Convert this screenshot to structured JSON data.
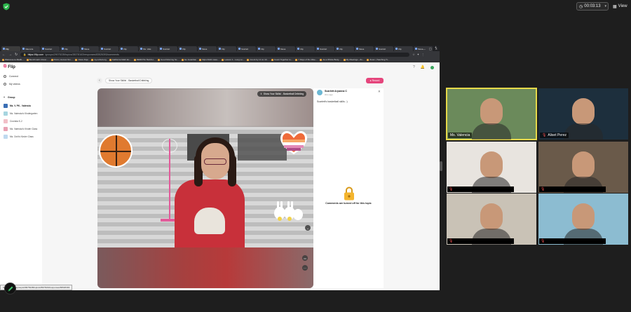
{
  "meeting": {
    "timer": "00:03:13",
    "view_label": "View",
    "colors": {
      "bar_bg": "#1e1e1e",
      "active_speaker": "#e6d94a",
      "mic_muted": "#ff5454"
    }
  },
  "browser": {
    "tabs": [
      "Flip",
      "Valencia",
      "Scarlett",
      "Flip",
      "Mesa",
      "Scarlett",
      "Flip",
      "Ms. Vale",
      "Scarlett",
      "Flip",
      "Mesa",
      "Flip",
      "Scarlett",
      "Flip",
      "Mesa",
      "Flip",
      "Scarlett",
      "Flip",
      "Mesa",
      "Scarlett",
      "Flip",
      "Mesa"
    ],
    "url_host": "https://flip.com",
    "url_path": "/groups/29075228/topics/28378163/responses/83526393/comments",
    "bookmarks": [
      "Welcome to Marlb...",
      "Benchmark Univer...",
      "Point | Human Sm...",
      "Class Dojo",
      "my.cuhsd.org",
      "California Math Ex...",
      "REMOTE TEACH...",
      "Good Morning Sc...",
      "Go Guardian",
      "https://kidz.nasa...",
      "Lesson 1 - Long vo...",
      "Count by 1's to 10...",
      "Count Together to...",
      "7 Days of the Wee...",
      "As a Whole Body...",
      "My Meetings - Zo...",
      "Zoom | Teaching Ti..."
    ],
    "status_tip": "https://flip.com/groups/29075228/topics/28378163/responses/83526393"
  },
  "flip": {
    "logo": "Flip",
    "nav": {
      "connect": "Connect",
      "my_videos": "My videos"
    },
    "group_header": "Group",
    "groups": [
      {
        "label": "Ms. V. PK - Valencia",
        "active": true,
        "color": "#3b6fb5"
      },
      {
        "label": "Ms. Valencia's Kindergarten",
        "active": false,
        "color": "#a7d5e0"
      },
      {
        "label": "Cronista K-2",
        "active": false,
        "color": "#f2c0c8"
      },
      {
        "label": "Ms. Valencia's Kinder Class",
        "active": false,
        "color": "#e8a1b3"
      },
      {
        "label": "Ms. Ochi's Kinder Class",
        "active": false,
        "color": "#bfd9ef"
      }
    ],
    "topic_title": "Show Your Skills! - Basketball Dribbling",
    "record_label": "Record",
    "video_title": "Show Your Skills! - Basketball Dribbling",
    "response": {
      "author": "Scarlett Aryanna C",
      "time": "2mo ago",
      "caption": "Scarlett's basketball skills. :)",
      "comments_off": "Comments are turned off for this topic"
    },
    "colors": {
      "brand": "#e5457c"
    }
  },
  "participants": [
    {
      "name": "Ms. Valencia",
      "muted": false,
      "active_speaker": true,
      "bg": "#6b8a5b"
    },
    {
      "name": "Aliset Perez",
      "muted": true,
      "active_speaker": false,
      "bg": "#1d2f3d"
    },
    {
      "name": "",
      "muted": true,
      "active_speaker": false,
      "bg": "#e8e4df"
    },
    {
      "name": "",
      "muted": true,
      "active_speaker": false,
      "bg": "#6a5a4a"
    },
    {
      "name": "",
      "muted": true,
      "active_speaker": false,
      "bg": "#c9c2b6"
    },
    {
      "name": "",
      "muted": true,
      "active_speaker": false,
      "bg": "#8cbcd1"
    }
  ]
}
